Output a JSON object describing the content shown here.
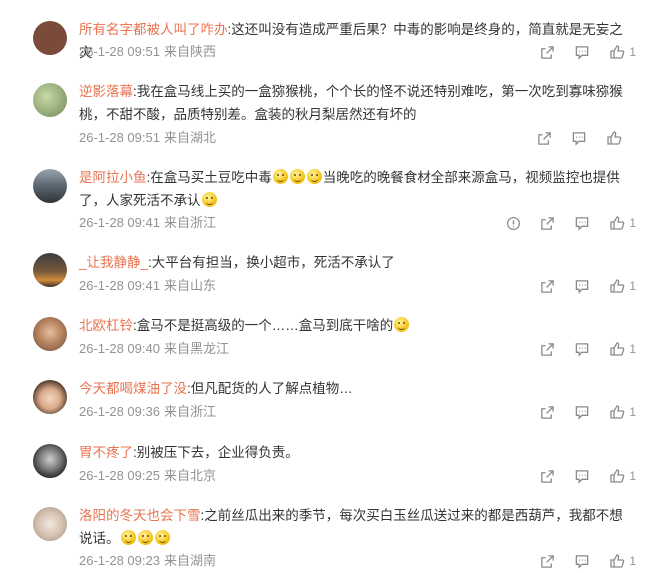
{
  "comments": [
    {
      "author": "所有名字都被人叫了咋办",
      "text": "这还叫没有造成严重后果？中毒的影响是终身的，简直就是无妄之灾",
      "time": "26-1-28 09:51",
      "source": "来自陕西",
      "likes": "1",
      "avatar_color": "#7a4a3a"
    },
    {
      "author": "逆影落幕",
      "text": "我在盒马线上买的一盒猕猴桃，个个长的怪不说还特别难吃，第一次吃到寡味猕猴桃，不甜不酸，品质特别差。盒装的秋月梨居然还有坏的",
      "time": "26-1-28 09:51",
      "source": "来自湖北",
      "likes": "",
      "avatar_color": "#9fb58a"
    },
    {
      "author": "是阿拉小鱼",
      "text_parts": [
        "在盒马买土豆吃中毒",
        "当晚吃的晚餐食材全部来源盒马，视频监控也提供了，人家死活不承认"
      ],
      "time": "26-1-28 09:41",
      "source": "来自浙江",
      "likes": "1",
      "avatar_color": "#4a5560"
    },
    {
      "author": "_让我静静_",
      "text": "大平台有担当，换小超市，死活不承认了",
      "time": "26-1-28 09:41",
      "source": "来自山东",
      "likes": "1",
      "avatar_color": "#c98a4a"
    },
    {
      "author": "北欧杠铃",
      "text": "盒马不是挺高级的一个……盒马到底干啥的",
      "time": "26-1-28 09:40",
      "source": "来自黑龙江",
      "likes": "1",
      "avatar_color": "#b58a6a"
    },
    {
      "author": "今天都喝煤油了没",
      "text": "但凡配货的人了解点植物…",
      "time": "26-1-28 09:36",
      "source": "来自浙江",
      "likes": "1",
      "avatar_color": "#caa890"
    },
    {
      "author": "胃不疼了",
      "text": "别被压下去，企业得负责。",
      "time": "26-1-28 09:25",
      "source": "来自北京",
      "likes": "1",
      "avatar_color": "#3a3a3a"
    },
    {
      "author": "洛阳的冬天也会下雪",
      "text": "之前丝瓜出来的季节，每次买白玉丝瓜送过来的都是西葫芦，我都不想说话。",
      "time": "26-1-28 09:23",
      "source": "来自湖南",
      "likes": "1",
      "avatar_color": "#d8c7b8"
    }
  ],
  "icons": [
    "share-icon",
    "comment-icon",
    "like-icon",
    "report-icon",
    "emoji-icon"
  ]
}
